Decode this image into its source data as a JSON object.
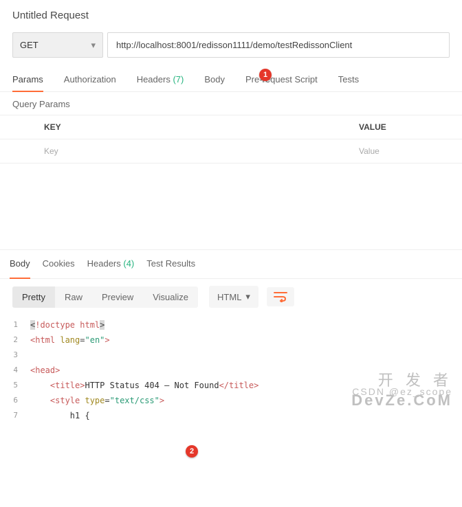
{
  "header": {
    "title": "Untitled Request"
  },
  "request": {
    "method": "GET",
    "url": "http://localhost:8001/redisson1111/demo/testRedissonClient",
    "tabs": [
      "Params",
      "Authorization",
      "Headers",
      "Body",
      "Pre-request Script",
      "Tests"
    ],
    "headers_count": "(7)"
  },
  "query": {
    "title": "Query Params",
    "columns": {
      "key": "KEY",
      "value": "VALUE"
    },
    "placeholders": {
      "key": "Key",
      "value": "Value"
    }
  },
  "response": {
    "tabs": [
      "Body",
      "Cookies",
      "Headers",
      "Test Results"
    ],
    "headers_count": "(4)",
    "modes": [
      "Pretty",
      "Raw",
      "Preview",
      "Visualize"
    ],
    "lang": "HTML",
    "code": {
      "l1": {
        "tag": "!doctype html"
      },
      "l2": {
        "open": "<html ",
        "attr": "lang",
        "eq": "=",
        "val": "\"en\"",
        "close": ">"
      },
      "l4": {
        "text": "<head>"
      },
      "l5": {
        "o": "<title>",
        "t": "HTTP Status 404 – Not Found",
        "c": "</title>"
      },
      "l6": {
        "o": "<style ",
        "attr": "type",
        "eq": "=",
        "val": "\"text/css\"",
        "c": ">"
      },
      "l7": {
        "text": "h1 {"
      }
    }
  },
  "markers": {
    "m1": "1",
    "m2": "2"
  },
  "watermark": {
    "l1": "开 发 者",
    "l2": "CSDN @ez_scope",
    "l3": "DevZe.CoM"
  }
}
